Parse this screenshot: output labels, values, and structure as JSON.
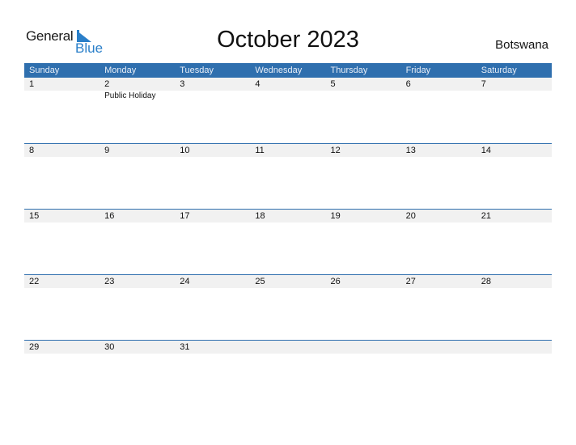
{
  "logo": {
    "word1": "General",
    "word2": "Blue"
  },
  "title": "October 2023",
  "country": "Botswana",
  "colors": {
    "accent": "#2f6fae",
    "logo_blue": "#2a7fc9",
    "date_strip": "#f1f1f1"
  },
  "weekdays": [
    "Sunday",
    "Monday",
    "Tuesday",
    "Wednesday",
    "Thursday",
    "Friday",
    "Saturday"
  ],
  "weeks": [
    {
      "days": [
        {
          "day": "1",
          "event": ""
        },
        {
          "day": "2",
          "event": "Public Holiday"
        },
        {
          "day": "3",
          "event": ""
        },
        {
          "day": "4",
          "event": ""
        },
        {
          "day": "5",
          "event": ""
        },
        {
          "day": "6",
          "event": ""
        },
        {
          "day": "7",
          "event": ""
        }
      ]
    },
    {
      "days": [
        {
          "day": "8",
          "event": ""
        },
        {
          "day": "9",
          "event": ""
        },
        {
          "day": "10",
          "event": ""
        },
        {
          "day": "11",
          "event": ""
        },
        {
          "day": "12",
          "event": ""
        },
        {
          "day": "13",
          "event": ""
        },
        {
          "day": "14",
          "event": ""
        }
      ]
    },
    {
      "days": [
        {
          "day": "15",
          "event": ""
        },
        {
          "day": "16",
          "event": ""
        },
        {
          "day": "17",
          "event": ""
        },
        {
          "day": "18",
          "event": ""
        },
        {
          "day": "19",
          "event": ""
        },
        {
          "day": "20",
          "event": ""
        },
        {
          "day": "21",
          "event": ""
        }
      ]
    },
    {
      "days": [
        {
          "day": "22",
          "event": ""
        },
        {
          "day": "23",
          "event": ""
        },
        {
          "day": "24",
          "event": ""
        },
        {
          "day": "25",
          "event": ""
        },
        {
          "day": "26",
          "event": ""
        },
        {
          "day": "27",
          "event": ""
        },
        {
          "day": "28",
          "event": ""
        }
      ]
    },
    {
      "days": [
        {
          "day": "29",
          "event": ""
        },
        {
          "day": "30",
          "event": ""
        },
        {
          "day": "31",
          "event": ""
        },
        {
          "day": "",
          "event": ""
        },
        {
          "day": "",
          "event": ""
        },
        {
          "day": "",
          "event": ""
        },
        {
          "day": "",
          "event": ""
        }
      ]
    }
  ]
}
